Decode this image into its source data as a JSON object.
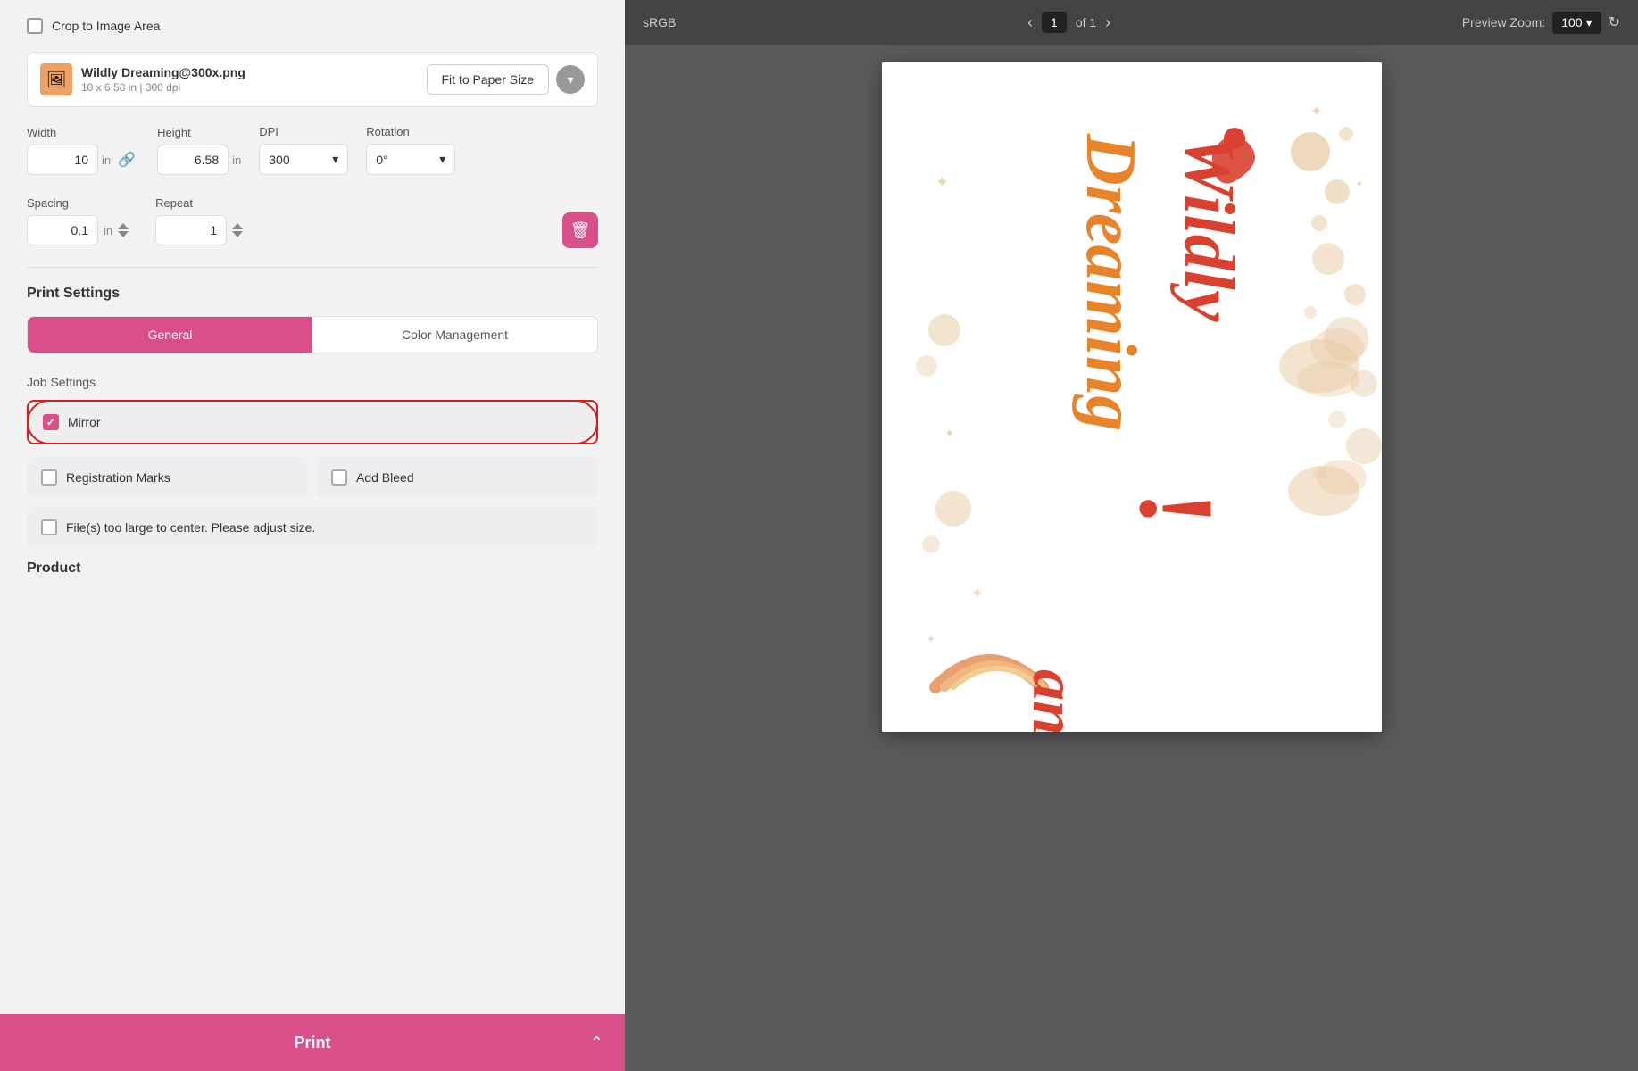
{
  "leftPanel": {
    "cropLabel": "Crop to Image Area",
    "fileName": "Wildly Dreaming@300x.png",
    "fileMeta": "10 x 6.58 in | 300 dpi",
    "fitButton": "Fit to Paper Size",
    "dimensions": {
      "widthLabel": "Width",
      "heightLabel": "Height",
      "dpiLabel": "DPI",
      "rotationLabel": "Rotation",
      "widthValue": "10",
      "widthUnit": "in",
      "heightValue": "6.58",
      "heightUnit": "in",
      "dpiValue": "300",
      "rotationValue": "0°"
    },
    "spacing": {
      "label": "Spacing",
      "value": "0.1",
      "unit": "in",
      "repeatLabel": "Repeat",
      "repeatValue": "1"
    },
    "printSettings": {
      "title": "Print Settings",
      "tabs": [
        "General",
        "Color Management"
      ],
      "activeTab": 0,
      "jobSettingsLabel": "Job Settings",
      "mirrorLabel": "Mirror",
      "mirrorChecked": true,
      "registrationMarksLabel": "Registration Marks",
      "addBleedLabel": "Add Bleed",
      "filesTooLargeLabel": "File(s) too large to center. Please adjust size.",
      "productLabel": "Product"
    }
  },
  "rightPanel": {
    "colorSpace": "sRGB",
    "pageNumber": "1",
    "pageOf": "of 1",
    "previewZoomLabel": "Preview Zoom:",
    "zoomValue": "100",
    "printLabel": "Print"
  }
}
